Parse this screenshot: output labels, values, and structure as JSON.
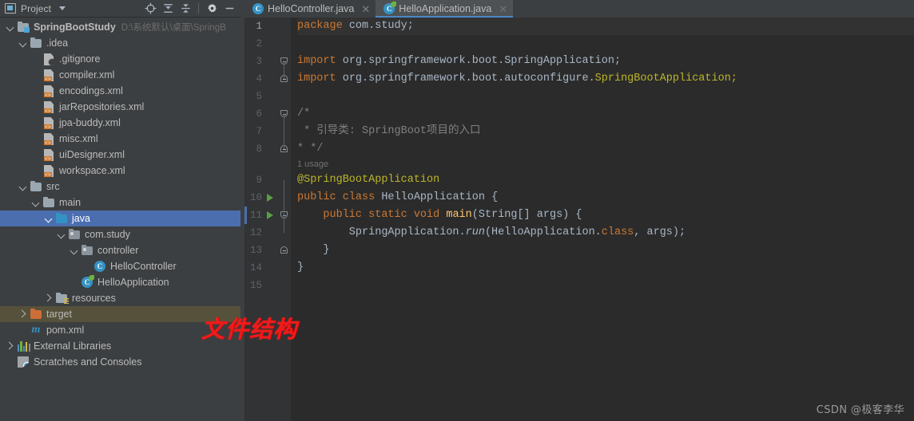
{
  "window": {
    "theme_colors": {
      "panel_bg": "#3c3f41",
      "editor_bg": "#2b2b2b",
      "gutter_bg": "#313335",
      "selection_blue": "#4b6eaf",
      "excluded_olive": "#56513b",
      "accent_blue": "#3592c4",
      "keyword_orange": "#cc7832",
      "annotation_yellow": "#bbb529",
      "annotation_red": "#ef1b1b"
    }
  },
  "project_panel": {
    "title": "Project",
    "title_icon": "project-window-icon",
    "dropdown_icon": "chevron-down-icon",
    "actions": [
      {
        "name": "scroll-from-source-icon",
        "tooltip": "Select Opened File"
      },
      {
        "name": "expand-all-icon",
        "tooltip": "Expand All"
      },
      {
        "name": "collapse-all-icon",
        "tooltip": "Collapse All"
      },
      {
        "name": "settings-gear-icon",
        "tooltip": "Options"
      },
      {
        "name": "hide-icon",
        "tooltip": "Hide"
      }
    ],
    "tree": [
      {
        "label": "SpringBootStudy",
        "path": "D:\\系统默认\\桌面\\SpringB",
        "icon": "module-folder-icon",
        "indent": 0,
        "arrow": "down",
        "bold": true,
        "state": "normal"
      },
      {
        "label": ".idea",
        "path": "",
        "icon": "folder-icon",
        "indent": 1,
        "arrow": "down",
        "bold": false,
        "state": "normal"
      },
      {
        "label": ".gitignore",
        "path": "",
        "icon": "gitignore-file-icon",
        "indent": 2,
        "arrow": "none",
        "bold": false,
        "state": "normal"
      },
      {
        "label": "compiler.xml",
        "path": "",
        "icon": "xml-file-icon",
        "indent": 2,
        "arrow": "none",
        "bold": false,
        "state": "normal"
      },
      {
        "label": "encodings.xml",
        "path": "",
        "icon": "xml-file-icon",
        "indent": 2,
        "arrow": "none",
        "bold": false,
        "state": "normal"
      },
      {
        "label": "jarRepositories.xml",
        "path": "",
        "icon": "xml-file-icon",
        "indent": 2,
        "arrow": "none",
        "bold": false,
        "state": "normal"
      },
      {
        "label": "jpa-buddy.xml",
        "path": "",
        "icon": "xml-file-icon",
        "indent": 2,
        "arrow": "none",
        "bold": false,
        "state": "normal"
      },
      {
        "label": "misc.xml",
        "path": "",
        "icon": "xml-file-icon",
        "indent": 2,
        "arrow": "none",
        "bold": false,
        "state": "normal"
      },
      {
        "label": "uiDesigner.xml",
        "path": "",
        "icon": "xml-file-icon",
        "indent": 2,
        "arrow": "none",
        "bold": false,
        "state": "normal"
      },
      {
        "label": "workspace.xml",
        "path": "",
        "icon": "xml-file-icon",
        "indent": 2,
        "arrow": "none",
        "bold": false,
        "state": "normal"
      },
      {
        "label": "src",
        "path": "",
        "icon": "folder-icon",
        "indent": 1,
        "arrow": "down",
        "bold": false,
        "state": "normal"
      },
      {
        "label": "main",
        "path": "",
        "icon": "folder-icon",
        "indent": 2,
        "arrow": "down",
        "bold": false,
        "state": "normal"
      },
      {
        "label": "java",
        "path": "",
        "icon": "source-root-folder-icon",
        "indent": 3,
        "arrow": "down",
        "bold": false,
        "state": "selected"
      },
      {
        "label": "com.study",
        "path": "",
        "icon": "package-icon",
        "indent": 4,
        "arrow": "down",
        "bold": false,
        "state": "normal"
      },
      {
        "label": "controller",
        "path": "",
        "icon": "package-icon",
        "indent": 5,
        "arrow": "down",
        "bold": false,
        "state": "normal"
      },
      {
        "label": "HelloController",
        "path": "",
        "icon": "java-class-icon",
        "indent": 6,
        "arrow": "none",
        "bold": false,
        "state": "normal"
      },
      {
        "label": "HelloApplication",
        "path": "",
        "icon": "java-runnable-class-icon",
        "indent": 5,
        "arrow": "none",
        "bold": false,
        "state": "normal"
      },
      {
        "label": "resources",
        "path": "",
        "icon": "resource-root-folder-icon",
        "indent": 3,
        "arrow": "right",
        "bold": false,
        "state": "normal"
      },
      {
        "label": "target",
        "path": "",
        "icon": "excluded-folder-icon",
        "indent": 1,
        "arrow": "right",
        "bold": false,
        "state": "excluded"
      },
      {
        "label": "pom.xml",
        "path": "",
        "icon": "maven-file-icon",
        "indent": 1,
        "arrow": "none",
        "bold": false,
        "state": "normal"
      },
      {
        "label": "External Libraries",
        "path": "",
        "icon": "external-libraries-icon",
        "indent": 0,
        "arrow": "right",
        "bold": false,
        "state": "normal"
      },
      {
        "label": "Scratches and Consoles",
        "path": "",
        "icon": "scratches-icon",
        "indent": 0,
        "arrow": "none",
        "bold": false,
        "state": "normal"
      }
    ]
  },
  "annotation": {
    "text": "文件结构"
  },
  "watermark": {
    "text": "CSDN @极客李华"
  },
  "editor": {
    "tabs": [
      {
        "label": "HelloController.java",
        "icon": "java-class-icon",
        "active": false,
        "close": "✕"
      },
      {
        "label": "HelloApplication.java",
        "icon": "java-runnable-class-icon",
        "active": true,
        "close": "✕"
      }
    ],
    "lines": [
      {
        "num": "1",
        "current": true,
        "run": false,
        "fold": "",
        "tokens": [
          {
            "t": "package ",
            "c": "kw"
          },
          {
            "t": "com.study;",
            "c": "id"
          }
        ]
      },
      {
        "num": "2",
        "current": false,
        "run": false,
        "fold": "",
        "tokens": []
      },
      {
        "num": "3",
        "current": false,
        "run": false,
        "fold": "down",
        "tokens": [
          {
            "t": "import ",
            "c": "kw"
          },
          {
            "t": "org.springframework.boot.SpringApplication;",
            "c": "id"
          }
        ]
      },
      {
        "num": "4",
        "current": false,
        "run": false,
        "fold": "up",
        "tokens": [
          {
            "t": "import ",
            "c": "kw"
          },
          {
            "t": "org.springframework.boot.autoconfigure.",
            "c": "id"
          },
          {
            "t": "SpringBootApplication;",
            "c": "yel"
          }
        ]
      },
      {
        "num": "5",
        "current": false,
        "run": false,
        "fold": "",
        "tokens": []
      },
      {
        "num": "6",
        "current": false,
        "run": false,
        "fold": "down",
        "tokens": [
          {
            "t": "/*",
            "c": "cmt"
          }
        ]
      },
      {
        "num": "7",
        "current": false,
        "run": false,
        "fold": "",
        "tokens": [
          {
            "t": " * 引导类: SpringBoot项目的入口",
            "c": "cmt"
          }
        ]
      },
      {
        "num": "8",
        "current": false,
        "run": false,
        "fold": "up",
        "tokens": [
          {
            "t": "* */",
            "c": "cmt"
          }
        ]
      },
      {
        "num": "",
        "current": false,
        "run": false,
        "fold": "",
        "hint": "1 usage"
      },
      {
        "num": "9",
        "current": false,
        "run": false,
        "fold": "",
        "tokens": [
          {
            "t": "@SpringBootApplication",
            "c": "ann"
          }
        ]
      },
      {
        "num": "10",
        "current": false,
        "run": true,
        "fold": "",
        "tokens": [
          {
            "t": "public class ",
            "c": "kw"
          },
          {
            "t": "HelloApplication ",
            "c": "id"
          },
          {
            "t": "{",
            "c": "id"
          }
        ]
      },
      {
        "num": "11",
        "current": false,
        "run": true,
        "fold": "down",
        "caret": true,
        "tokens": [
          {
            "t": "    public static void ",
            "c": "kw"
          },
          {
            "t": "main",
            "c": "fn"
          },
          {
            "t": "(String[] args) {",
            "c": "id"
          }
        ]
      },
      {
        "num": "12",
        "current": false,
        "run": false,
        "fold": "",
        "tokens": [
          {
            "t": "        SpringApplication.",
            "c": "id"
          },
          {
            "t": "run",
            "c": "italic"
          },
          {
            "t": "(HelloApplication.",
            "c": "id"
          },
          {
            "t": "class",
            "c": "kw"
          },
          {
            "t": ", args);",
            "c": "id"
          }
        ]
      },
      {
        "num": "13",
        "current": false,
        "run": false,
        "fold": "up",
        "tokens": [
          {
            "t": "    }",
            "c": "id"
          }
        ]
      },
      {
        "num": "14",
        "current": false,
        "run": false,
        "fold": "",
        "tokens": [
          {
            "t": "}",
            "c": "id"
          }
        ]
      },
      {
        "num": "15",
        "current": false,
        "run": false,
        "fold": "",
        "tokens": []
      }
    ]
  }
}
